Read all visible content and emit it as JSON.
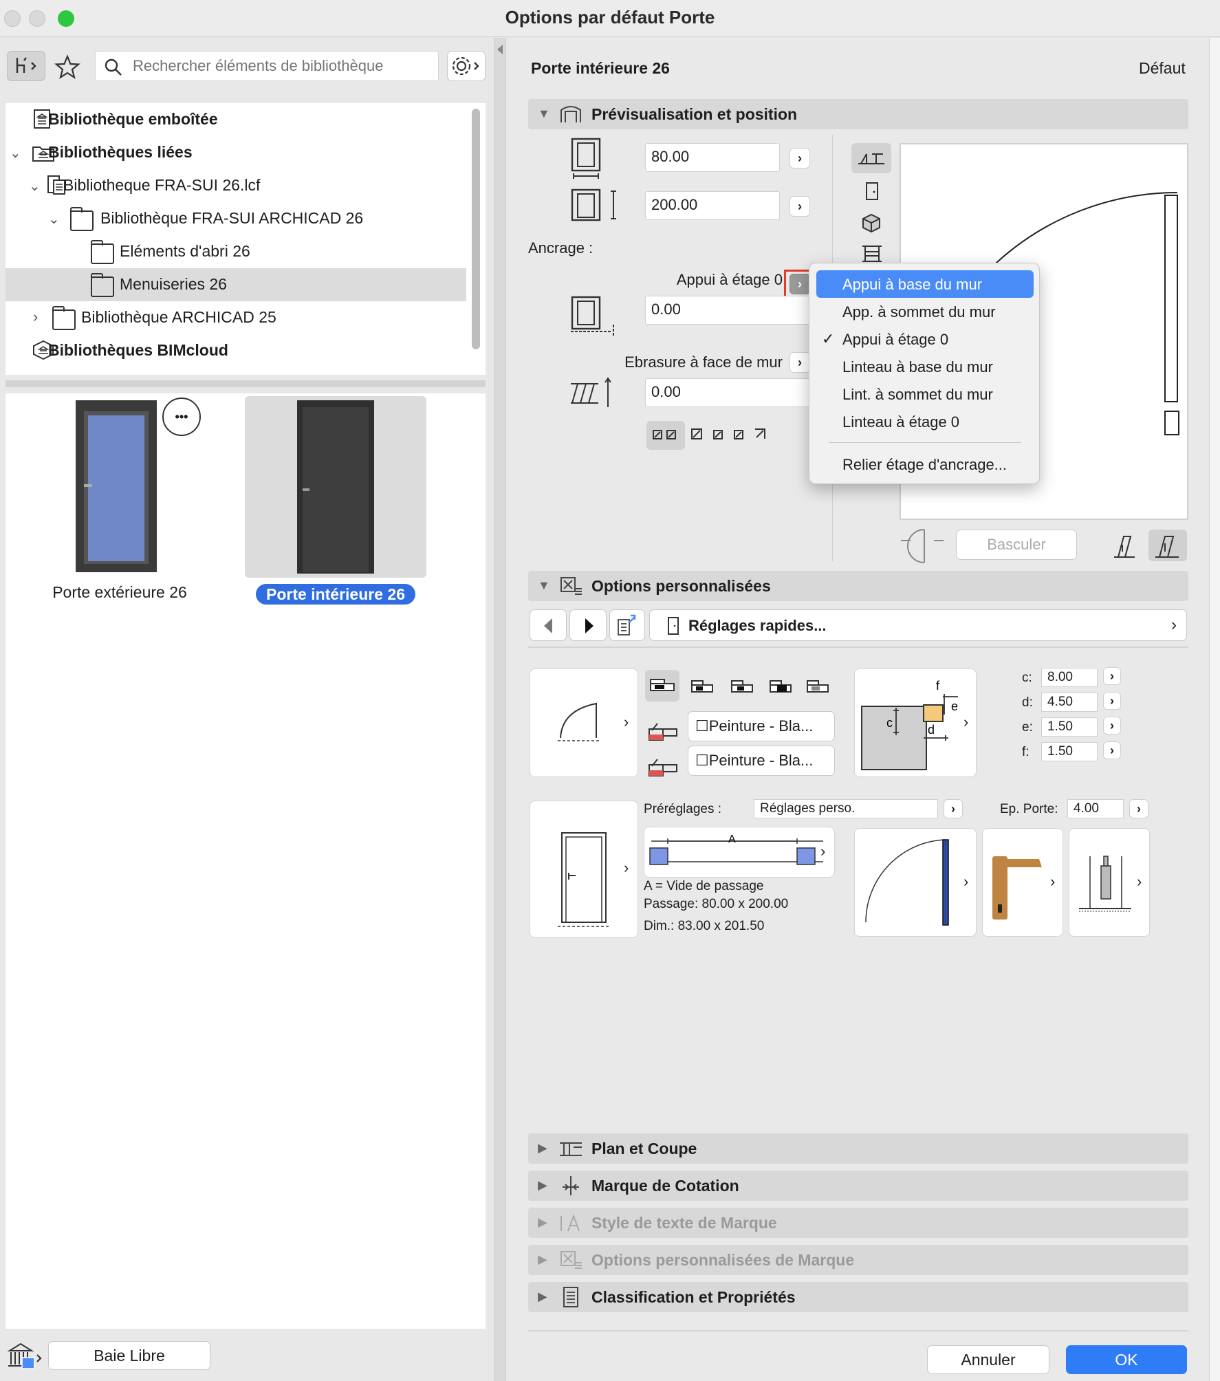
{
  "window": {
    "title": "Options par défaut Porte"
  },
  "left": {
    "search_placeholder": "Rechercher éléments de bibliothèque",
    "tree": [
      {
        "label": "Bibliothèque emboîtée",
        "bold": true
      },
      {
        "label": "Bibliothèques liées",
        "bold": true
      },
      {
        "label": "Bibliotheque FRA-SUI 26.lcf"
      },
      {
        "label": "Bibliothèque FRA-SUI ARCHICAD 26"
      },
      {
        "label": "Eléments d'abri 26"
      },
      {
        "label": "Menuiseries 26",
        "selected": true
      },
      {
        "label": "Bibliothèque ARCHICAD 25"
      },
      {
        "label": "Bibliothèques BIMcloud",
        "bold": true
      }
    ],
    "items": [
      {
        "label": "Porte extérieure 26"
      },
      {
        "label": "Porte intérieure 26",
        "selected": true
      }
    ],
    "more_label": "•••",
    "baie_libre": "Baie Libre"
  },
  "right": {
    "element_name": "Porte intérieure 26",
    "default_label": "Défaut",
    "sections": {
      "preview": "Prévisualisation et position",
      "custom": "Options personnalisées",
      "plan": "Plan et Coupe",
      "cotation": "Marque de Cotation",
      "text_style": "Style de texte de Marque",
      "marque_opts": "Options personnalisées de Marque",
      "classification": "Classification et Propriétés"
    },
    "width": "80.00",
    "height": "200.00",
    "ancrage_label": "Ancrage :",
    "appui_label": "Appui à étage 0",
    "anchor_value": "0.00",
    "ebrasure_label": "Ebrasure à face de mur",
    "ebrasure_value": "0.00",
    "basculer": "Basculer",
    "quick_settings": "Réglages rapides...",
    "paint1": "☐Peinture - Bla...",
    "paint2": "☐Peinture - Bla...",
    "dims": [
      {
        "k": "c:",
        "v": "8.00"
      },
      {
        "k": "d:",
        "v": "4.50"
      },
      {
        "k": "e:",
        "v": "1.50"
      },
      {
        "k": "f:",
        "v": "1.50"
      }
    ],
    "presets_label": "Préréglages :",
    "presets_value": "Réglages perso.",
    "ep_label": "Ep. Porte:",
    "ep_value": "4.00",
    "info": [
      "A = Vide de passage",
      "Passage: 80.00 x 200.00",
      "Dim.: 83.00 x 201.50"
    ],
    "diagram_letters": {
      "a": "A",
      "c": "c",
      "d": "d",
      "e": "e",
      "f": "f"
    },
    "cancel": "Annuler",
    "ok": "OK"
  },
  "menu": {
    "items": [
      {
        "label": "Appui à base du mur",
        "selected": true
      },
      {
        "label": "App. à sommet du mur"
      },
      {
        "label": "Appui à étage 0",
        "checked": true
      },
      {
        "label": "Linteau à base du mur"
      },
      {
        "label": "Lint. à sommet du mur"
      },
      {
        "label": "Linteau à étage 0"
      },
      {
        "label": "Relier étage d'ancrage..."
      }
    ],
    "check": "✓"
  },
  "colors": {
    "accent": "#4a8cf7",
    "highlight_box": "#e03c2c",
    "door_glass": "#6f89c8",
    "door_dark": "#3a3a3a"
  }
}
